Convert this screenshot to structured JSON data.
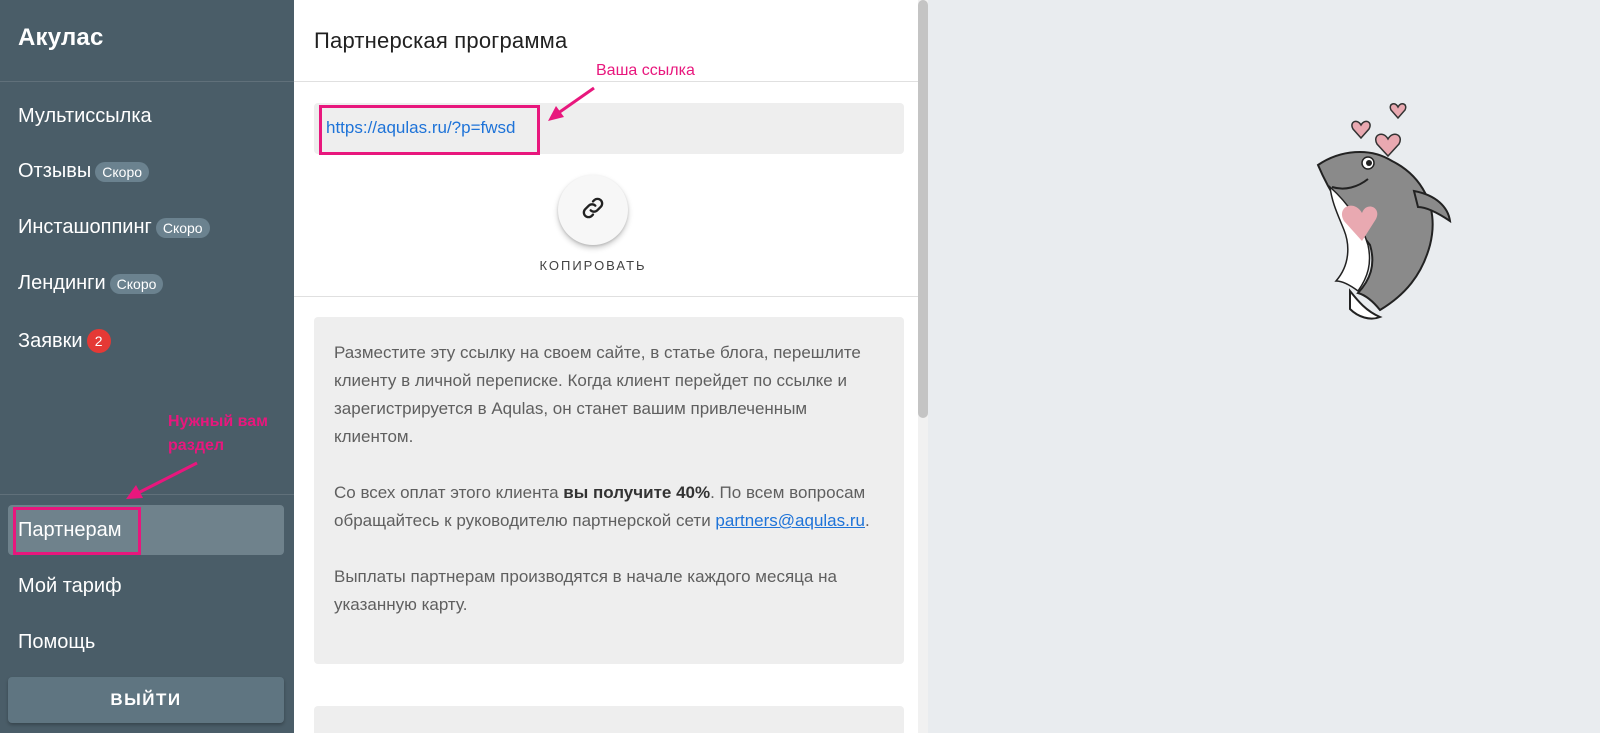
{
  "sidebar": {
    "brand": "Акулас",
    "items": [
      {
        "label": "Мультиссылка"
      },
      {
        "label": "Отзывы",
        "badge": "Скоро"
      },
      {
        "label": "Инсташоппинг",
        "badge": "Скоро"
      },
      {
        "label": "Лендинги",
        "badge": "Скоро"
      },
      {
        "label": "Заявки",
        "count": "2"
      }
    ],
    "bottom_items": [
      {
        "label": "Партнерам",
        "active": true
      },
      {
        "label": "Мой тариф"
      },
      {
        "label": "Помощь"
      }
    ],
    "logout_label": "ВЫЙТИ"
  },
  "main": {
    "title": "Партнерская программа",
    "referral_link": "https://aqulas.ru/?p=fwsd",
    "copy_label": "КОПИРОВАТЬ",
    "info": {
      "p1": "Разместите эту ссылку на своем сайте, в статье блога, перешлите клиенту в личной переписке. Когда клиент перейдет по ссылке и зарегистрируется в Aqulas, он станет вашим привлеченным клиентом.",
      "p2_before": "Со всех оплат этого клиента ",
      "p2_bold": "вы получите 40%",
      "p2_after": ". По всем вопросам обращайтесь к руководителю партнерской сети ",
      "p2_email": "partners@aqulas.ru",
      "p2_end": ".",
      "p3": "Выплаты партнерам производятся в начале каждого месяца на указанную карту."
    }
  },
  "annotations": {
    "link_note": "Ваша ссылка",
    "section_note_line1": "Нужный вам",
    "section_note_line2": "раздел"
  },
  "colors": {
    "sidebar_bg": "#4a5d68",
    "active_item_bg": "#6f828c",
    "annotation": "#e8177d",
    "link": "#1e73d8",
    "badge_count": "#e53935"
  }
}
